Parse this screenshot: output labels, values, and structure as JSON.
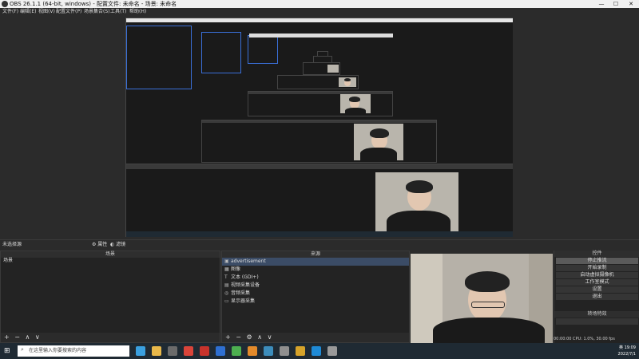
{
  "window": {
    "title": "OBS 26.1.1 (64-bit, windows) - 配置文件: 未命名 - 场景: 未命名",
    "min": "—",
    "max": "☐",
    "close": "✕"
  },
  "menu": [
    "文件(F)",
    "编辑(E)",
    "视图(V)",
    "配置文件(P)",
    "场景集合(S)",
    "工具(T)",
    "帮助(H)"
  ],
  "scenebar": {
    "label": "未选择源",
    "props": "属性",
    "filters": "滤镜"
  },
  "scenes": {
    "header": "场景",
    "items": [
      "场景"
    ]
  },
  "sources": {
    "header": "来源",
    "items": [
      {
        "icon": "monitor-icon",
        "glyph": "▣",
        "label": "advertisement",
        "selected": true
      },
      {
        "icon": "image-icon",
        "glyph": "▦",
        "label": "图像",
        "selected": false
      },
      {
        "icon": "text-icon",
        "glyph": "T",
        "label": "文本 (GDI+)",
        "selected": false
      },
      {
        "icon": "camera-icon",
        "glyph": "▤",
        "label": "视频采集设备",
        "selected": false
      },
      {
        "icon": "audio-icon",
        "glyph": "◎",
        "label": "音频采集",
        "selected": false
      },
      {
        "icon": "display-icon",
        "glyph": "▭",
        "label": "显示器采集",
        "selected": false
      }
    ]
  },
  "controls": {
    "header": "控件",
    "buttons": [
      "停止推流",
      "开始录制",
      "启动虚拟摄像机",
      "工作室模式",
      "设置",
      "退出"
    ],
    "active_index": 0,
    "transition_header": "转场特效"
  },
  "status": {
    "text": "00:00:00   CPU: 1.0%, 30.00 fps"
  },
  "taskbar": {
    "search_placeholder": "在这里输入你要搜索的内容",
    "time": "19:09",
    "date": "2022/7/1",
    "lang": "英",
    "icons": [
      "#3aa0e0",
      "#e8b84a",
      "#6b6b6b",
      "#d9443a",
      "#c7332c",
      "#2e6fd1",
      "#4caf50",
      "#e28a2b",
      "#3c8dbc",
      "#8f8f8f",
      "#d6a32a",
      "#1e8ad6",
      "#999999"
    ]
  },
  "nested": {
    "label": "OBS 26.1.1 (64-bit, windows)"
  }
}
